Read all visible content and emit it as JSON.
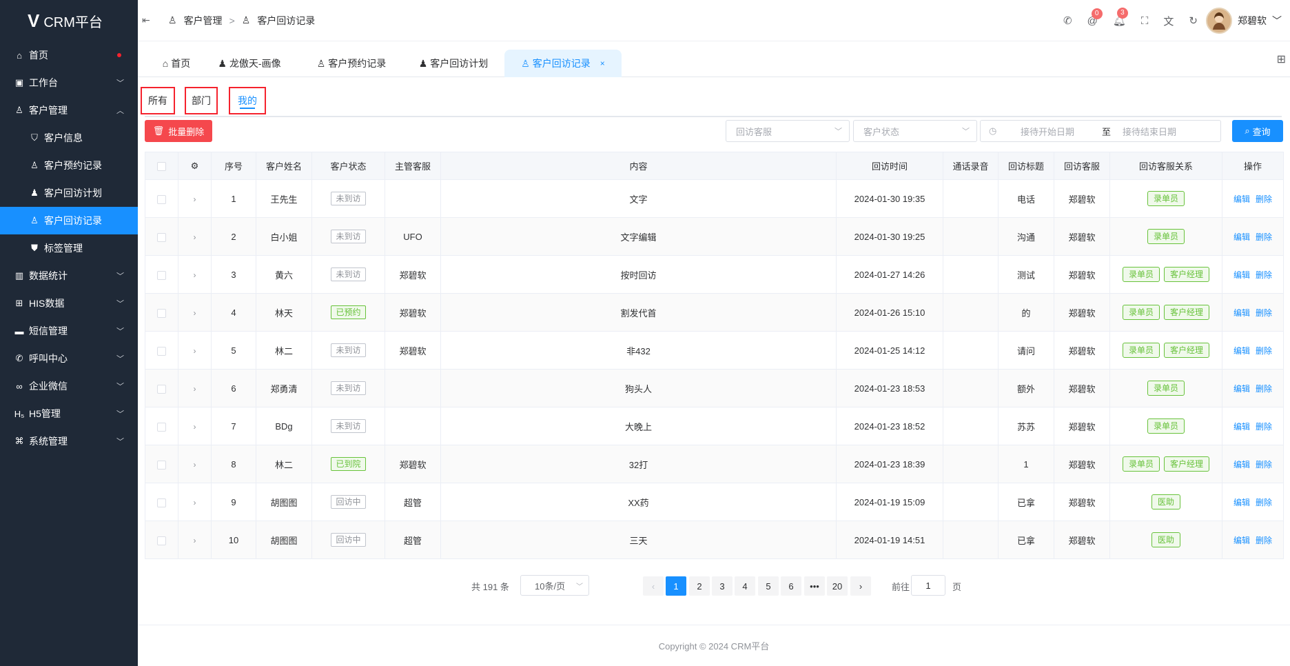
{
  "app": {
    "logo_mark": "V",
    "logo_text": "CRM平台"
  },
  "sidebar": {
    "items": [
      {
        "label": "首页",
        "icon": "home-icon"
      },
      {
        "label": "工作台",
        "icon": "briefcase-icon"
      },
      {
        "label": "客户管理",
        "icon": "user-icon"
      },
      {
        "label": "客户信息",
        "icon": "shield-user-icon"
      },
      {
        "label": "客户预约记录",
        "icon": "user-icon"
      },
      {
        "label": "客户回访计划",
        "icon": "user-filled-icon"
      },
      {
        "label": "客户回访记录",
        "icon": "user-icon"
      },
      {
        "label": "标签管理",
        "icon": "tag-shield-icon"
      },
      {
        "label": "数据统计",
        "icon": "bar-chart-icon"
      },
      {
        "label": "HIS数据",
        "icon": "medkit-icon"
      },
      {
        "label": "短信管理",
        "icon": "message-icon"
      },
      {
        "label": "呼叫中心",
        "icon": "phone-icon"
      },
      {
        "label": "企业微信",
        "icon": "wechat-icon"
      },
      {
        "label": "H5管理",
        "icon": "h5-icon"
      },
      {
        "label": "系统管理",
        "icon": "command-icon"
      }
    ]
  },
  "header": {
    "breadcrumb": [
      "客户管理",
      "客户回访记录"
    ],
    "mention_badge": "0",
    "bell_badge": "3",
    "username": "郑碧软"
  },
  "tabs": [
    "首页",
    "龙傲天-画像",
    "客户预约记录",
    "客户回访计划",
    "客户回访记录"
  ],
  "scope_tabs": [
    "所有",
    "部门",
    "我的"
  ],
  "toolbar": {
    "batch_delete": "批量删除",
    "agent_placeholder": "回访客服",
    "status_placeholder": "客户状态",
    "start_placeholder": "接待开始日期",
    "range_sep": "至",
    "end_placeholder": "接待结束日期",
    "query": "查询"
  },
  "table": {
    "columns": [
      "序号",
      "客户姓名",
      "客户状态",
      "主管客服",
      "内容",
      "回访时间",
      "通话录音",
      "回访标题",
      "回访客服",
      "回访客服关系",
      "操作"
    ],
    "rows": [
      {
        "no": "1",
        "name": "王先生",
        "status": "未到访",
        "status_green": false,
        "manager": "",
        "content": "文字",
        "time": "2024-01-30 19:35",
        "recording": "",
        "title": "电话",
        "agent": "郑碧软",
        "relations": [
          "录单员"
        ]
      },
      {
        "no": "2",
        "name": "白小姐",
        "status": "未到访",
        "status_green": false,
        "manager": "UFO",
        "content": "文字编辑",
        "time": "2024-01-30 19:25",
        "recording": "",
        "title": "沟通",
        "agent": "郑碧软",
        "relations": [
          "录单员"
        ]
      },
      {
        "no": "3",
        "name": "黄六",
        "status": "未到访",
        "status_green": false,
        "manager": "郑碧软",
        "content": "按时回访",
        "time": "2024-01-27 14:26",
        "recording": "",
        "title": "测试",
        "agent": "郑碧软",
        "relations": [
          "录单员",
          "客户经理"
        ]
      },
      {
        "no": "4",
        "name": "林天",
        "status": "已预约",
        "status_green": true,
        "manager": "郑碧软",
        "content": "割发代首",
        "time": "2024-01-26 15:10",
        "recording": "",
        "title": "的",
        "agent": "郑碧软",
        "relations": [
          "录单员",
          "客户经理"
        ]
      },
      {
        "no": "5",
        "name": "林二",
        "status": "未到访",
        "status_green": false,
        "manager": "郑碧软",
        "content": "非432",
        "time": "2024-01-25 14:12",
        "recording": "",
        "title": "请问",
        "agent": "郑碧软",
        "relations": [
          "录单员",
          "客户经理"
        ]
      },
      {
        "no": "6",
        "name": "郑勇清",
        "status": "未到访",
        "status_green": false,
        "manager": "",
        "content": "狗头人",
        "time": "2024-01-23 18:53",
        "recording": "",
        "title": "额外",
        "agent": "郑碧软",
        "relations": [
          "录单员"
        ]
      },
      {
        "no": "7",
        "name": "BDg",
        "status": "未到访",
        "status_green": false,
        "manager": "",
        "content": "大晚上",
        "time": "2024-01-23 18:52",
        "recording": "",
        "title": "苏苏",
        "agent": "郑碧软",
        "relations": [
          "录单员"
        ]
      },
      {
        "no": "8",
        "name": "林二",
        "status": "已到院",
        "status_green": true,
        "manager": "郑碧软",
        "content": "32打",
        "time": "2024-01-23 18:39",
        "recording": "",
        "title": "1",
        "agent": "郑碧软",
        "relations": [
          "录单员",
          "客户经理"
        ]
      },
      {
        "no": "9",
        "name": "胡图图",
        "status": "回访中",
        "status_green": false,
        "manager": "超管",
        "content": "XX药",
        "time": "2024-01-19 15:09",
        "recording": "",
        "title": "已拿",
        "agent": "郑碧软",
        "relations": [
          "医助"
        ]
      },
      {
        "no": "10",
        "name": "胡图图",
        "status": "回访中",
        "status_green": false,
        "manager": "超管",
        "content": "三天",
        "time": "2024-01-19 14:51",
        "recording": "",
        "title": "已拿",
        "agent": "郑碧软",
        "relations": [
          "医助"
        ]
      }
    ],
    "edit_label": "编辑",
    "delete_label": "删除"
  },
  "pagination": {
    "total": "共 191 条",
    "page_size": "10条/页",
    "pages": [
      "1",
      "2",
      "3",
      "4",
      "5",
      "6",
      "•••",
      "20"
    ],
    "current": "1",
    "goto_label": "前往",
    "goto_value": "1",
    "page_suffix": "页"
  },
  "footer": {
    "copyright": "Copyright © 2024 CRM平台"
  },
  "colors": {
    "primary": "#1890ff",
    "danger": "#f5484d",
    "sidebar_bg": "#1f2937",
    "success": "#67c23a"
  }
}
